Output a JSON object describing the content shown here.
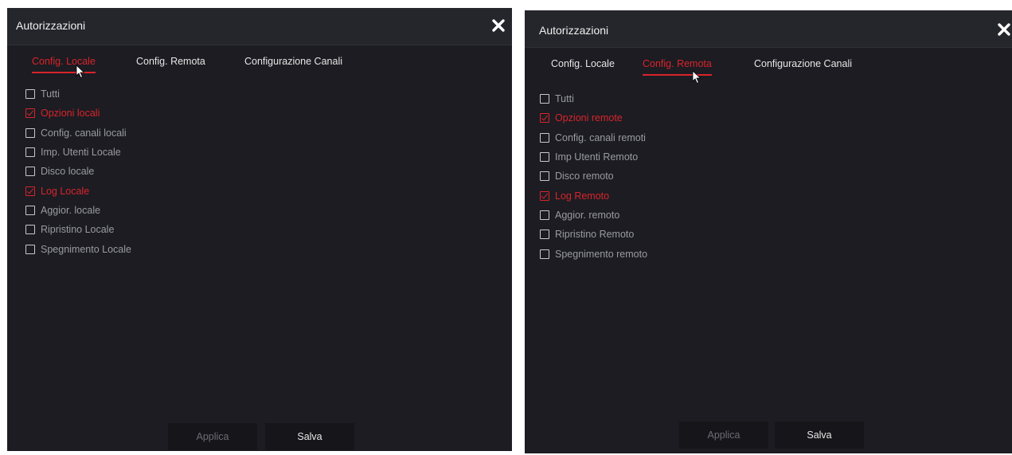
{
  "left_dialog": {
    "title": "Autorizzazioni",
    "tabs": [
      {
        "label": "Config. Locale",
        "active": true
      },
      {
        "label": "Config. Remota",
        "active": false
      },
      {
        "label": "Configurazione Canali",
        "active": false
      }
    ],
    "items": [
      {
        "label": "Tutti",
        "checked": false
      },
      {
        "label": "Opzioni locali",
        "checked": true
      },
      {
        "label": "Config. canali locali",
        "checked": false
      },
      {
        "label": "Imp. Utenti Locale",
        "checked": false
      },
      {
        "label": "Disco locale",
        "checked": false
      },
      {
        "label": "Log Locale",
        "checked": true
      },
      {
        "label": "Aggior. locale",
        "checked": false
      },
      {
        "label": "Ripristino Locale",
        "checked": false
      },
      {
        "label": "Spegnimento Locale",
        "checked": false
      }
    ],
    "apply_label": "Applica",
    "save_label": "Salva"
  },
  "right_dialog": {
    "title": "Autorizzazioni",
    "tabs": [
      {
        "label": "Config. Locale",
        "active": false
      },
      {
        "label": "Config. Remota",
        "active": true
      },
      {
        "label": "Configurazione Canali",
        "active": false
      }
    ],
    "items": [
      {
        "label": "Tutti",
        "checked": false
      },
      {
        "label": "Opzioni remote",
        "checked": true
      },
      {
        "label": "Config. canali remoti",
        "checked": false
      },
      {
        "label": "Imp Utenti Remoto",
        "checked": false
      },
      {
        "label": "Disco remoto",
        "checked": false
      },
      {
        "label": "Log Remoto",
        "checked": true
      },
      {
        "label": "Aggior. remoto",
        "checked": false
      },
      {
        "label": "Ripristino Remoto",
        "checked": false
      },
      {
        "label": "Spegnimento remoto",
        "checked": false
      }
    ],
    "apply_label": "Applica",
    "save_label": "Salva"
  },
  "colors": {
    "accent": "#d9242b",
    "background": "#1c1c22",
    "header": "#25252c",
    "button": "#15151a"
  }
}
